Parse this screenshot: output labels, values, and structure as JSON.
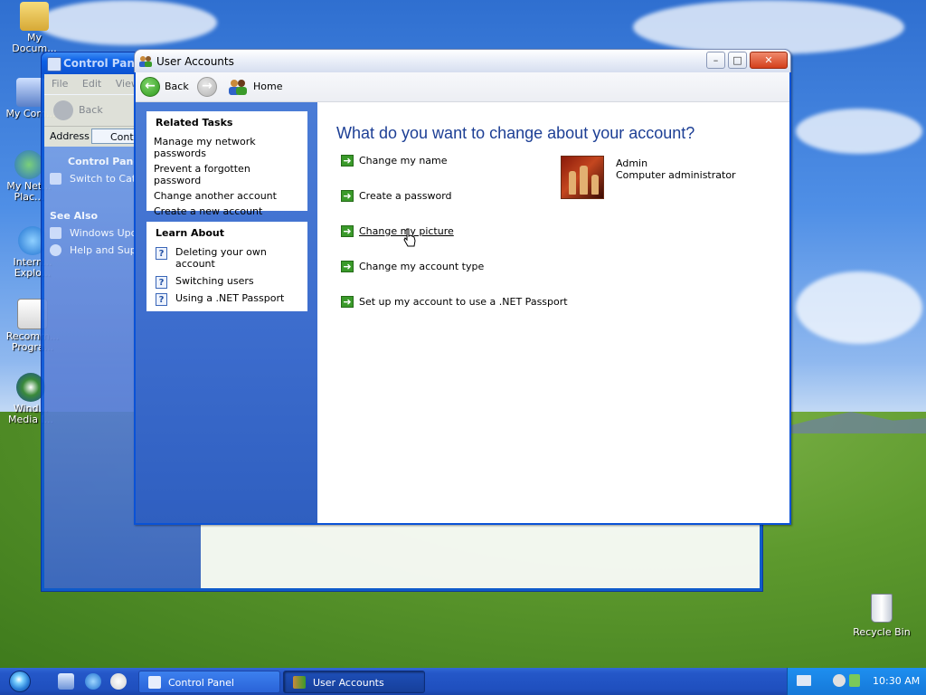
{
  "desktop": {
    "icons": [
      {
        "label_1": "My",
        "label_2": "Docum..."
      },
      {
        "label_1": "My Com...",
        "label_2": ""
      },
      {
        "label_1": "My Net...",
        "label_2": "Plac..."
      },
      {
        "label_1": "Intern...",
        "label_2": "Explo..."
      },
      {
        "label_1": "Recomm...",
        "label_2": "Progra..."
      },
      {
        "label_1": "Wind...",
        "label_2": "Media l..."
      }
    ],
    "recycle_bin": "Recycle Bin"
  },
  "control_panel_window": {
    "title": "Control Panel",
    "menu": [
      "File",
      "Edit",
      "View"
    ],
    "back_label": "Back",
    "address_label": "Address",
    "address_value": "Cont...",
    "sidebar_heading": "Control Panel",
    "switch_label": "Switch to Cate...",
    "see_also_heading": "See Also",
    "see_also": [
      "Windows Upd...",
      "Help and Supp..."
    ]
  },
  "user_accounts_window": {
    "title": "User Accounts",
    "nav": {
      "back_label": "Back",
      "home_label": "Home"
    },
    "related_tasks": {
      "heading": "Related Tasks",
      "items": [
        "Manage my network passwords",
        "Prevent a forgotten password",
        "Change another account",
        "Create a new account"
      ]
    },
    "learn_about": {
      "heading": "Learn About",
      "items": [
        "Deleting your own account",
        "Switching users",
        "Using a .NET Passport"
      ]
    },
    "main_heading": "What do you want to change about your account?",
    "tasks": [
      "Change my name",
      "Create a password",
      "Change my picture",
      "Change my account type",
      "Set up my account to use a .NET Passport"
    ],
    "account": {
      "name": "Admin",
      "type": "Computer administrator"
    }
  },
  "taskbar": {
    "buttons": [
      "Control Panel",
      "User Accounts"
    ],
    "clock": "10:30 AM"
  },
  "colors": {
    "heading": "#1d3f95",
    "sidebar": "#3b6bcc",
    "taskbar": "#2457c8"
  }
}
